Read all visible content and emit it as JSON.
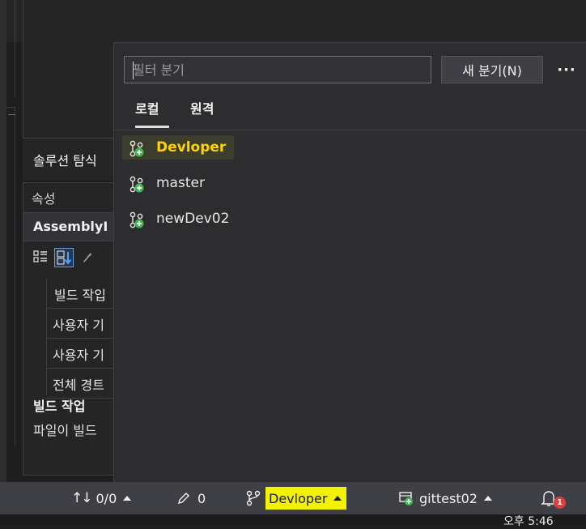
{
  "background": {
    "solution_explorer_label": "솔루션 탐식",
    "properties": {
      "header": "속성",
      "object_name": "AssemblyI",
      "rows": [
        "빌드 작입",
        "사용자 기",
        "사용자 기",
        "전체 경트"
      ],
      "description_title": "빌드 작업",
      "description_text": "파일이 빌드"
    }
  },
  "branch_popup": {
    "filter_placeholder": "필터 분기",
    "new_branch_label": "새 분기(N)",
    "more_label": "···",
    "tabs": [
      {
        "label": "로컬",
        "selected": true
      },
      {
        "label": "원격",
        "selected": false
      }
    ],
    "branches": [
      {
        "name": "Devloper",
        "current": true
      },
      {
        "name": "master",
        "current": false
      },
      {
        "name": "newDev02",
        "current": false
      }
    ]
  },
  "status_bar": {
    "sync_label": "0/0",
    "changes_label": "0",
    "branch_label": "Devloper",
    "repo_label": "gittest02",
    "notification_count": "1"
  },
  "taskbar": {
    "clock": "오후 5:46"
  },
  "colors": {
    "accent_yellow": "#f3f300",
    "branch_icon_green": "#3fb950",
    "current_branch_text": "#ffd400"
  },
  "icons": [
    "branch-icon",
    "sync-icon",
    "pencil-icon",
    "repo-icon",
    "bell-icon",
    "more-icon",
    "sort-az-icon",
    "categorized-icon",
    "wrench-icon"
  ]
}
